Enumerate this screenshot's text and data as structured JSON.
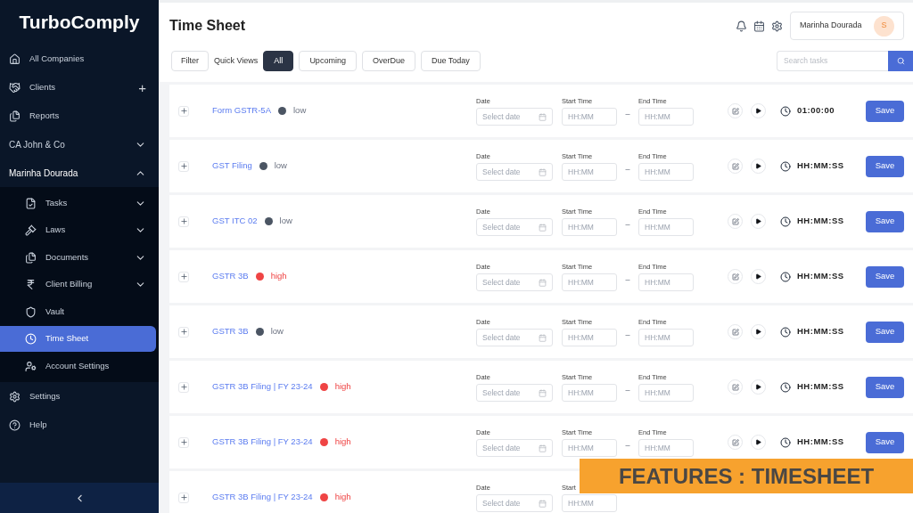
{
  "sidebar": {
    "logo": "TurboComply",
    "items": [
      {
        "label": "All Companies",
        "kind": "link"
      },
      {
        "label": "Clients",
        "kind": "add",
        "add": "+"
      },
      {
        "label": "Reports",
        "kind": "link"
      },
      {
        "label": "CA John & Co",
        "kind": "group",
        "expanded": false
      },
      {
        "label": "Marinha Dourada",
        "kind": "group",
        "expanded": true,
        "children": [
          {
            "label": "Tasks",
            "kind": "dropdown",
            "expanded": false,
            "selected": false
          },
          {
            "label": "Laws",
            "kind": "dropdown",
            "expanded": false,
            "selected": false
          },
          {
            "label": "Documents",
            "kind": "dropdown",
            "expanded": false,
            "selected": false
          },
          {
            "label": "Client Billing",
            "kind": "dropdown",
            "expanded": false,
            "selected": false
          },
          {
            "label": "Vault",
            "kind": "link",
            "selected": false
          },
          {
            "label": "Time Sheet",
            "kind": "link",
            "selected": true
          },
          {
            "label": "Account Settings",
            "kind": "link",
            "selected": false
          }
        ]
      },
      {
        "label": "Settings",
        "kind": "link"
      },
      {
        "label": "Help",
        "kind": "link"
      }
    ]
  },
  "header": {
    "title": "Time Sheet",
    "user": "Marinha Dourada",
    "avatar": "S"
  },
  "toolbar": {
    "filter": "Filter",
    "quick_views_label": "Quick Views",
    "views": [
      {
        "label": "All",
        "selected": true
      },
      {
        "label": "Upcoming",
        "selected": false
      },
      {
        "label": "OverDue",
        "selected": false
      },
      {
        "label": "Due Today",
        "selected": false
      }
    ],
    "search": {
      "placeholder": "Search tasks"
    }
  },
  "rows": [
    {
      "name": "Form GSTR-5A",
      "priority": {
        "label": "low",
        "kind": "low",
        "color": "#4b5563"
      },
      "date_label": "Date",
      "date_placeholder": "Select date",
      "start_label": "Start Time",
      "start_placeholder": "HH:MM",
      "separator": "–",
      "end_label": "End Time",
      "end_placeholder": "HH:MM",
      "timer": "01:00:00",
      "save": "Save"
    },
    {
      "name": "GST Filing",
      "priority": {
        "label": "low",
        "kind": "low",
        "color": "#4b5563"
      },
      "date_label": "Date",
      "date_placeholder": "Select date",
      "start_label": "Start Time",
      "start_placeholder": "HH:MM",
      "separator": "–",
      "end_label": "End Time",
      "end_placeholder": "HH:MM",
      "timer": "HH:MM:SS",
      "save": "Save"
    },
    {
      "name": "GST ITC 02",
      "priority": {
        "label": "low",
        "kind": "low",
        "color": "#4b5563"
      },
      "date_label": "Date",
      "date_placeholder": "Select date",
      "start_label": "Start Time",
      "start_placeholder": "HH:MM",
      "separator": "–",
      "end_label": "End Time",
      "end_placeholder": "HH:MM",
      "timer": "HH:MM:SS",
      "save": "Save"
    },
    {
      "name": "GSTR 3B",
      "priority": {
        "label": "high",
        "kind": "high",
        "color": "#ef4444"
      },
      "date_label": "Date",
      "date_placeholder": "Select date",
      "start_label": "Start Time",
      "start_placeholder": "HH:MM",
      "separator": "–",
      "end_label": "End Time",
      "end_placeholder": "HH:MM",
      "timer": "HH:MM:SS",
      "save": "Save"
    },
    {
      "name": "GSTR 3B",
      "priority": {
        "label": "low",
        "kind": "low",
        "color": "#4b5563"
      },
      "date_label": "Date",
      "date_placeholder": "Select date",
      "start_label": "Start Time",
      "start_placeholder": "HH:MM",
      "separator": "–",
      "end_label": "End Time",
      "end_placeholder": "HH:MM",
      "timer": "HH:MM:SS",
      "save": "Save"
    },
    {
      "name": "GSTR 3B Filing | FY 23-24",
      "priority": {
        "label": "high",
        "kind": "high",
        "color": "#ef4444"
      },
      "date_label": "Date",
      "date_placeholder": "Select date",
      "start_label": "Start Time",
      "start_placeholder": "HH:MM",
      "separator": "–",
      "end_label": "End Time",
      "end_placeholder": "HH:MM",
      "timer": "HH:MM:SS",
      "save": "Save"
    },
    {
      "name": "GSTR 3B Filing | FY 23-24",
      "priority": {
        "label": "high",
        "kind": "high",
        "color": "#ef4444"
      },
      "date_label": "Date",
      "date_placeholder": "Select date",
      "start_label": "Start Time",
      "start_placeholder": "HH:MM",
      "separator": "–",
      "end_label": "End Time",
      "end_placeholder": "HH:MM",
      "timer": "HH:MM:SS",
      "save": "Save"
    },
    {
      "name": "GSTR 3B Filing | FY 23-24",
      "priority": {
        "label": "high",
        "kind": "high",
        "color": "#ef4444"
      },
      "date_label": "Date",
      "date_placeholder": "Select date",
      "start_label": "Start",
      "start_placeholder": "HH:MM"
    }
  ],
  "banner": "FEATURES : TIMESHEET"
}
